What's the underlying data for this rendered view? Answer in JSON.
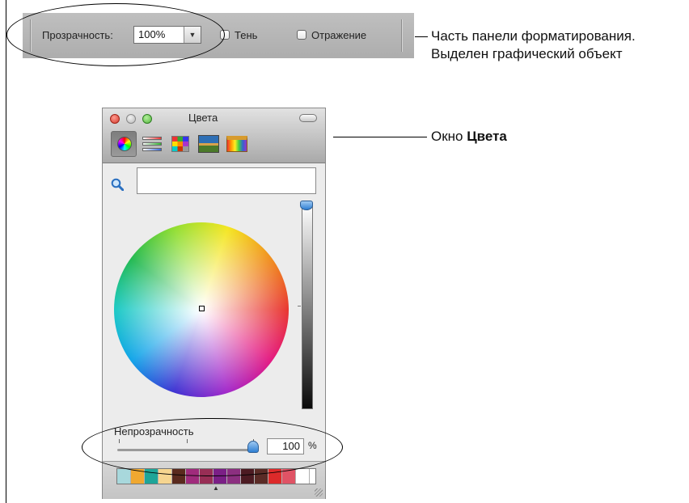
{
  "format_bar": {
    "opacity_label": "Прозрачность:",
    "opacity_value": "100%",
    "shadow_label": "Тень",
    "reflection_label": "Отражение"
  },
  "callouts": {
    "format_bar_line1": "Часть панели форматирования.",
    "format_bar_line2": "Выделен графический объект",
    "window_prefix": "Окно ",
    "window_name": "Цвета"
  },
  "colors_window": {
    "title": "Цвета",
    "tabs": [
      {
        "name": "color-wheel-icon"
      },
      {
        "name": "color-sliders-icon"
      },
      {
        "name": "color-palettes-icon"
      },
      {
        "name": "image-palettes-icon"
      },
      {
        "name": "crayons-icon"
      }
    ],
    "search_placeholder": "",
    "brightness": 1.0,
    "opacity_label": "Непрозрачность",
    "opacity_value": "100",
    "opacity_unit": "%",
    "swatches": [
      "#a8d8dc",
      "#f0a830",
      "#1ea598",
      "#f6d590",
      "#5a2a1e",
      "#a02b7c",
      "#982e55",
      "#7b1f86",
      "#8c2f80",
      "#4c1b22",
      "#5a2b26",
      "#dd2a2a",
      "#e05365",
      "#ffffff"
    ]
  }
}
